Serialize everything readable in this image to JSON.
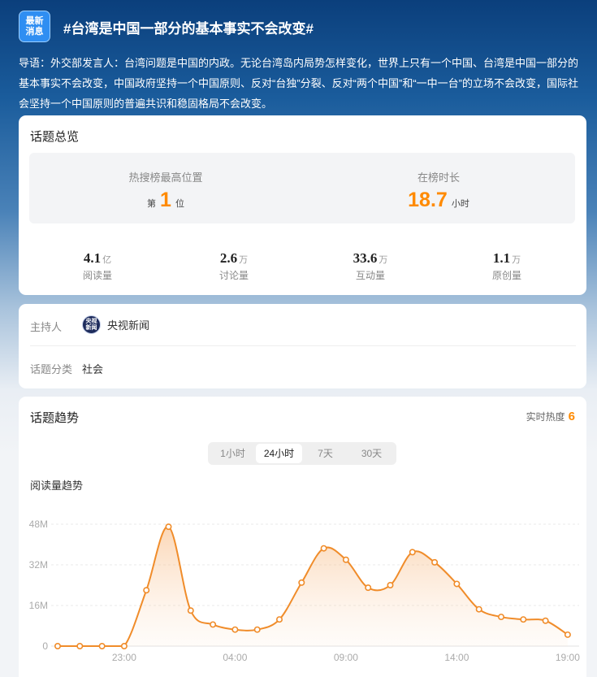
{
  "header": {
    "badge_line1": "最新",
    "badge_line2": "消息",
    "title": "#台湾是中国一部分的基本事实不会改变#",
    "lead": "导语：外交部发言人：台湾问题是中国的内政。无论台湾岛内局势怎样变化，世界上只有一个中国、台湾是中国一部分的基本事实不会改变，中国政府坚持一个中国原则、反对“台独”分裂、反对“两个中国”和“一中一台”的立场不会改变，国际社会坚持一个中国原则的普遍共识和稳固格局不会改变。"
  },
  "overview": {
    "title": "话题总览",
    "rank_label": "热搜榜最高位置",
    "rank_prefix": "第",
    "rank_value": "1",
    "rank_suffix": "位",
    "duration_label": "在榜时长",
    "duration_value": "18.7",
    "duration_unit": "小时",
    "stats": [
      {
        "value": "4.1",
        "unit": "亿",
        "label": "阅读量"
      },
      {
        "value": "2.6",
        "unit": "万",
        "label": "讨论量"
      },
      {
        "value": "33.6",
        "unit": "万",
        "label": "互动量"
      },
      {
        "value": "1.1",
        "unit": "万",
        "label": "原创量"
      }
    ]
  },
  "info": {
    "host_label": "主持人",
    "host_avatar_line1": "央视",
    "host_avatar_line2": "新闻",
    "host_name": "央视新闻",
    "category_label": "话题分类",
    "category_value": "社会"
  },
  "trend": {
    "title": "话题趋势",
    "heat_label": "实时热度",
    "heat_value": "6",
    "tabs": [
      "1小时",
      "24小时",
      "7天",
      "30天"
    ],
    "active_tab": 1,
    "chart_label": "阅读量趋势"
  },
  "colors": {
    "accent": "#ff8a00",
    "line": "#f08c2a"
  },
  "chart_data": {
    "type": "area",
    "title": "阅读量趋势",
    "xlabel": "",
    "ylabel": "",
    "ylim": [
      0,
      48
    ],
    "y_ticks": [
      "0",
      "16M",
      "32M",
      "48M"
    ],
    "y_tick_values": [
      0,
      16,
      32,
      48
    ],
    "x_tick_labels": [
      "23:00",
      "04:00",
      "09:00",
      "14:00",
      "19:00"
    ],
    "x_tick_indices": [
      3,
      8,
      13,
      18,
      23
    ],
    "series": [
      {
        "values": [
          0,
          0,
          0,
          0,
          22,
          47,
          14,
          8.5,
          6.5,
          6.5,
          10.5,
          25,
          38.5,
          34,
          23,
          24,
          37,
          33,
          24.5,
          14.5,
          11.5,
          10.5,
          10,
          4.5
        ]
      }
    ],
    "grid": true,
    "legend": "none"
  }
}
